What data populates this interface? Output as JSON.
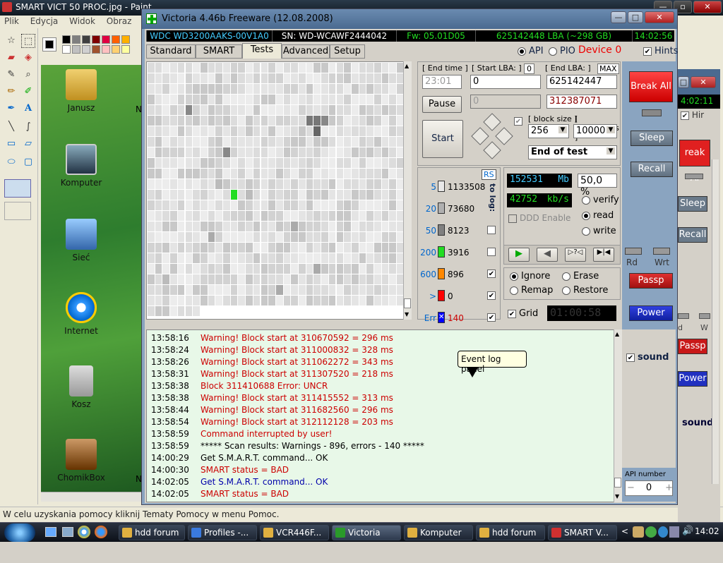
{
  "paint": {
    "title": "SMART VICT 50 PROC.jpg - Paint",
    "menu": [
      "Plik",
      "Edycja",
      "Widok",
      "Obraz",
      "Ko"
    ],
    "status": "W celu uzyskania pomocy kliknij Tematy Pomocy w menu Pomoc.",
    "desktop_icons": [
      {
        "label": "Janusz",
        "icon": "folder-icon"
      },
      {
        "label": "Komputer",
        "icon": "computer-icon"
      },
      {
        "label": "Sieć",
        "icon": "network-icon"
      },
      {
        "label": "Internet",
        "icon": "ie-icon"
      },
      {
        "label": "Kosz",
        "icon": "recycle-bin-icon"
      },
      {
        "label": "ChomikBox",
        "icon": "chomikbox-icon"
      }
    ],
    "cut_labels": {
      "m1": "N",
      "m3": "N"
    }
  },
  "victoria": {
    "title": "Victoria 4.46b Freeware (12.08.2008)",
    "info": {
      "model": "WDC WD3200AAKS-00V1A0",
      "serial": "SN: WD-WCAWF2444042",
      "firmware": "Fw: 05.01D05",
      "lba": "625142448 LBA (~298 GB)",
      "time": "14:02:56"
    },
    "tabs": [
      "Standard",
      "SMART",
      "Tests",
      "Advanced",
      "Setup"
    ],
    "api_label": "API",
    "pio_label": "PIO",
    "device": "Device 0",
    "hints": "Hints",
    "end_time_label": "[ End time ]",
    "start_lba_label": "[ Start LBA: ]",
    "start_lba_zero": "0",
    "end_lba_label": "[ End LBA: ]",
    "max_label": "MAX",
    "end_time_value": "23:01",
    "start_lba_value": "0",
    "end_lba_value": "625142447",
    "cur_lba_grey": "0",
    "cur_lba_value": "312387071",
    "pause": "Pause",
    "start": "Start",
    "block_size_label": "[ block size ]",
    "timeout_label": "[ timeout,ms ]",
    "block_size": "256",
    "timeout": "10000",
    "end_mode": "End of test",
    "rs": "RS",
    "to_log": "to log:",
    "legend": [
      {
        "label": "5",
        "count": "1133508",
        "color": "#e8e8e8"
      },
      {
        "label": "20",
        "count": "73680",
        "color": "#b0b0b0"
      },
      {
        "label": "50",
        "count": "8123",
        "color": "#808080"
      },
      {
        "label": "200",
        "count": "3916",
        "color": "#22dd22"
      },
      {
        "label": "600",
        "count": "896",
        "color": "#ff8800"
      },
      {
        "label": ">",
        "count": "0",
        "color": "#ff0000"
      },
      {
        "label": "Err",
        "count": "140",
        "color": "#0000ff"
      }
    ],
    "mb_value": "152531",
    "mb_unit": "Mb",
    "percent": "50,0",
    "percent_unit": "%",
    "speed": "42752",
    "speed_unit": "kb/s",
    "verify": "verify",
    "read": "read",
    "write": "write",
    "ddd": "DDD Enable",
    "ignore": "Ignore",
    "erase": "Erase",
    "remap": "Remap",
    "restore": "Restore",
    "grid": "Grid",
    "timer": "01:00:58",
    "break_all": "Break All",
    "sleep": "Sleep",
    "recall": "Recall",
    "rd": "Rd",
    "wrt": "Wrt",
    "passp": "Passp",
    "power": "Power",
    "sound": "sound",
    "api_number_label": "API number",
    "api_number": "0",
    "tooltip": "Event log panel",
    "log": [
      {
        "time": "13:58:16",
        "msg": "Warning! Block start at 310670592 = 296 ms",
        "color": "#cc0000"
      },
      {
        "time": "13:58:24",
        "msg": "Warning! Block start at 311000832 = 328 ms",
        "color": "#cc0000"
      },
      {
        "time": "13:58:26",
        "msg": "Warning! Block start at 311062272 = 343 ms",
        "color": "#cc0000"
      },
      {
        "time": "13:58:31",
        "msg": "Warning! Block start at 311307520 = 218 ms",
        "color": "#cc0000"
      },
      {
        "time": "13:58:38",
        "msg": "Block 311410688 Error: UNCR",
        "color": "#cc0000"
      },
      {
        "time": "13:58:38",
        "msg": "Warning! Block start at 311415552 = 313 ms",
        "color": "#cc0000"
      },
      {
        "time": "13:58:44",
        "msg": "Warning! Block start at 311682560 = 296 ms",
        "color": "#cc0000"
      },
      {
        "time": "13:58:54",
        "msg": "Warning! Block start at 312112128 = 203 ms",
        "color": "#cc0000"
      },
      {
        "time": "13:58:59",
        "msg": "Command interrupted by user!",
        "color": "#cc0000"
      },
      {
        "time": "13:58:59",
        "msg": "***** Scan results: Warnings - 896, errors - 140 *****",
        "color": "#000000"
      },
      {
        "time": "14:00:29",
        "msg": "Get S.M.A.R.T. command... OK",
        "color": "#000000"
      },
      {
        "time": "14:00:30",
        "msg": "SMART status = BAD",
        "color": "#cc0000"
      },
      {
        "time": "14:02:05",
        "msg": "Get S.M.A.R.T. command... OK",
        "color": "#0000aa"
      },
      {
        "time": "14:02:05",
        "msg": "SMART status = BAD",
        "color": "#cc0000"
      }
    ]
  },
  "behind": {
    "clock": "4:02:11",
    "hints": "Hir",
    "break": "reak Al",
    "sleep": "Sleep",
    "recall": "Recall",
    "rd": "d",
    "w": "W",
    "passp": "Passp",
    "power": "Power",
    "sound": "sound"
  },
  "taskbar": {
    "items": [
      "hdd forum",
      "Profiles -...",
      "VCR446F...",
      "Victoria",
      "Komputer",
      "hdd forum",
      "SMART V..."
    ],
    "clock": "14:02",
    "chevron": "<"
  }
}
